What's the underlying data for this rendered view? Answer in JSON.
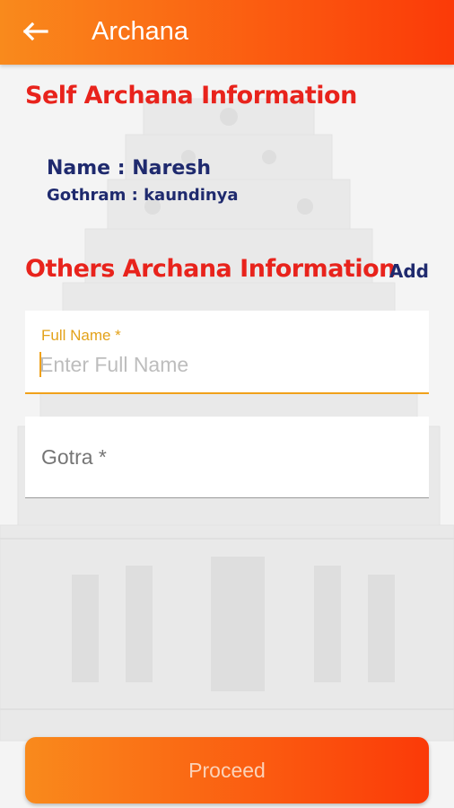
{
  "appbar": {
    "title": "Archana",
    "back_icon": "arrow-left-icon",
    "gradient": [
      "#f98a1c",
      "#fb3a08"
    ]
  },
  "self_section": {
    "title": "Self Archana Information",
    "name_line": "Name : Naresh",
    "gothram_line": "Gothram : kaundinya"
  },
  "others_section": {
    "title": "Others Archana Information",
    "add_label": "Add"
  },
  "form": {
    "full_name": {
      "label": "Full Name *",
      "placeholder": "Enter Full Name",
      "value": ""
    },
    "gotra": {
      "label": "Gotra *",
      "value": ""
    }
  },
  "proceed_button": {
    "label": "Proceed"
  },
  "colors": {
    "accent_red": "#e8231c",
    "navy_text": "#1f2a6e",
    "focus_amber": "#f0a11a"
  }
}
